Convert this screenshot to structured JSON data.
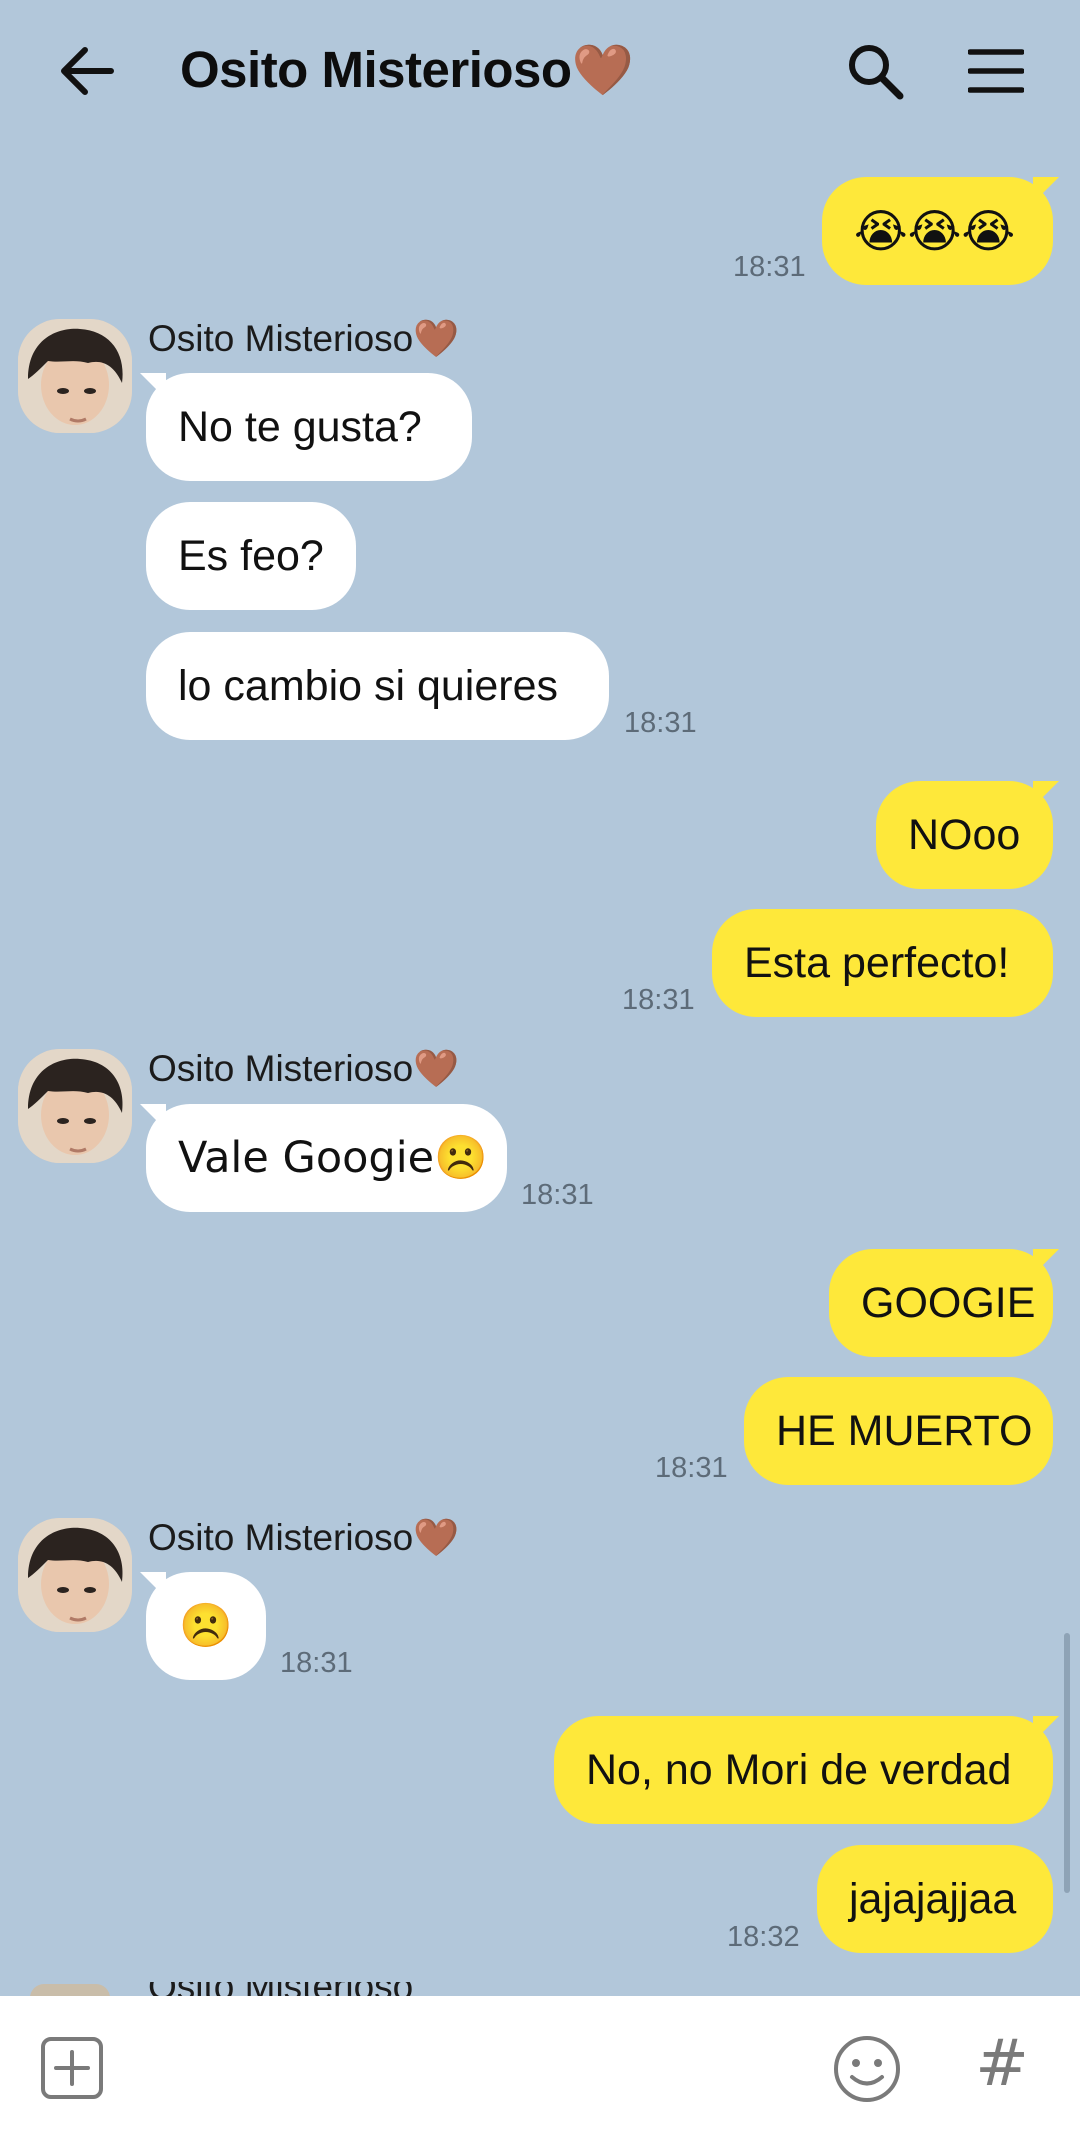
{
  "header": {
    "title": "Osito Misterioso",
    "title_heart": "🤎",
    "back_icon": "arrow-left-icon",
    "search_icon": "search-icon",
    "menu_icon": "hamburger-menu-icon"
  },
  "colors": {
    "background": "#b2c7da",
    "outgoing_bubble": "#fee83a",
    "incoming_bubble": "#ffffff",
    "timestamp": "#5d6b78"
  },
  "contact": {
    "name": "Osito Misterioso",
    "heart": "🤎"
  },
  "messages": [
    {
      "dir": "out",
      "text": "😭😭😭",
      "time": "18:31"
    },
    {
      "dir": "in",
      "text": "No te gusta?"
    },
    {
      "dir": "in",
      "text": "Es feo?"
    },
    {
      "dir": "in",
      "text": "lo cambio si quieres",
      "time": "18:31"
    },
    {
      "dir": "out",
      "text": "NOoo"
    },
    {
      "dir": "out",
      "text": "Esta perfecto!",
      "time": "18:31"
    },
    {
      "dir": "in",
      "text": "Vale Googie☹️",
      "time": "18:31"
    },
    {
      "dir": "out",
      "text": "GOOGIE"
    },
    {
      "dir": "out",
      "text": "HE MUERTO",
      "time": "18:31"
    },
    {
      "dir": "in",
      "text": "☹️",
      "time": "18:31"
    },
    {
      "dir": "out",
      "text": "No, no Mori de verdad"
    },
    {
      "dir": "out",
      "text": "jajajajjaa",
      "time": "18:32"
    }
  ],
  "bottom_bar": {
    "plus_icon": "plus-square-icon",
    "emoji_icon": "smiley-icon",
    "hashtag_label": "#"
  }
}
